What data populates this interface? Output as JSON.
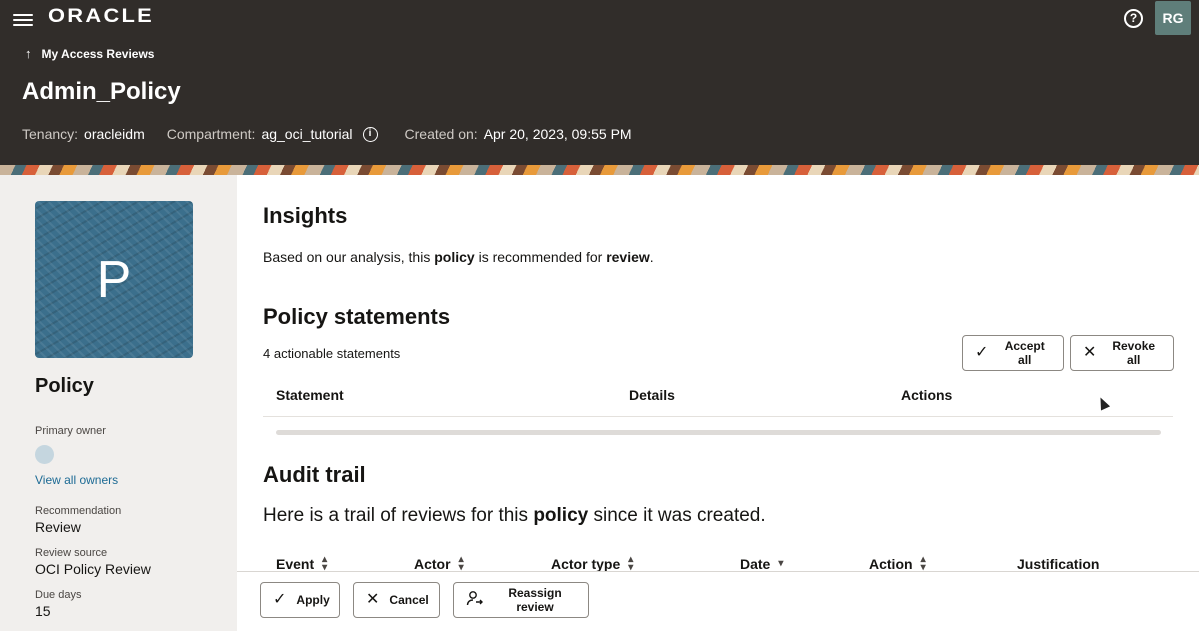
{
  "header": {
    "brand": "ORACLE",
    "user_initials": "RG",
    "back_link": "My Access Reviews",
    "title": "Admin_Policy",
    "tenancy_label": "Tenancy:",
    "tenancy_value": "oracleidm",
    "compartment_label": "Compartment:",
    "compartment_value": "ag_oci_tutorial",
    "created_label": "Created on:",
    "created_value": "Apr 20, 2023, 09:55 PM"
  },
  "sidebar": {
    "tile_letter": "P",
    "title": "Policy",
    "primary_owner_label": "Primary owner",
    "view_owners": "View all owners",
    "recommendation_label": "Recommendation",
    "recommendation_value": "Review",
    "review_source_label": "Review source",
    "review_source_value": "OCI Policy Review",
    "due_days_label": "Due days",
    "due_days_value": "15"
  },
  "insights": {
    "heading": "Insights",
    "text_pre": "Based on our analysis, this ",
    "text_b1": "policy",
    "text_mid": " is recommended for ",
    "text_b2": "review",
    "text_end": "."
  },
  "statements": {
    "heading": "Policy statements",
    "count_text": "4 actionable statements",
    "accept_all": "Accept all",
    "revoke_all": "Revoke all",
    "columns": [
      "Statement",
      "Details",
      "Actions"
    ]
  },
  "audit": {
    "heading": "Audit trail",
    "text_pre": "Here is a trail of reviews for this ",
    "text_b": "policy",
    "text_end": " since it was created.",
    "columns": [
      "Event",
      "Actor",
      "Actor type",
      "Date",
      "Action",
      "Justification"
    ]
  },
  "footer": {
    "apply": "Apply",
    "cancel": "Cancel",
    "reassign": "Reassign review"
  },
  "icons": {
    "menu": "hamburger-icon",
    "help": "help-icon",
    "info": "info-icon",
    "check": "check-icon",
    "close": "close-icon",
    "reassign": "person-arrow-icon"
  }
}
